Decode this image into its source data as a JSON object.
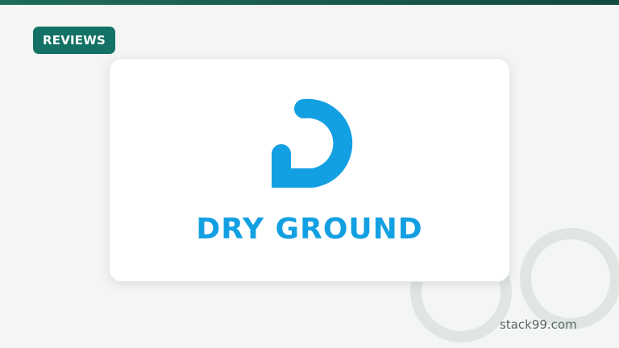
{
  "badge": {
    "label": "REVIEWS"
  },
  "card": {
    "logo_icon": "dry-ground-logo-icon",
    "brand_name": "DRY GROUND"
  },
  "footer": {
    "site": "stack99.com"
  },
  "colors": {
    "accent": "#137265",
    "brand_blue": "#13a0e2",
    "background": "#f4f6f5"
  }
}
